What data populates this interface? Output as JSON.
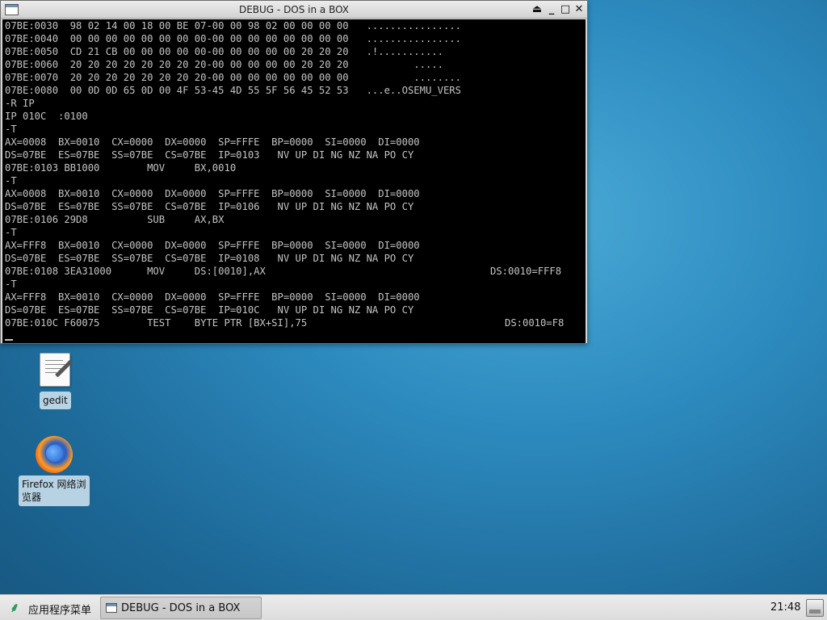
{
  "window": {
    "title": "DEBUG - DOS in a BOX",
    "controls": {
      "shade": "⏏",
      "minimize": "_",
      "maximize": "□",
      "close": "✕"
    },
    "lines": [
      "07BE:0030  98 02 14 00 18 00 BE 07-00 00 98 02 00 00 00 00   ................",
      "07BE:0040  00 00 00 00 00 00 00 00-00 00 00 00 00 00 00 00   ................",
      "07BE:0050  CD 21 CB 00 00 00 00 00-00 00 00 00 00 20 20 20   .!...........",
      "07BE:0060  20 20 20 20 20 20 20 20-00 00 00 00 00 20 20 20           .....",
      "07BE:0070  20 20 20 20 20 20 20 20-00 00 00 00 00 00 00 00           ........",
      "07BE:0080  00 0D 0D 65 0D 00 4F 53-45 4D 55 5F 56 45 52 53   ...e..OSEMU_VERS",
      "-R IP",
      "IP 010C  :0100",
      "-T",
      "AX=0008  BX=0010  CX=0000  DX=0000  SP=FFFE  BP=0000  SI=0000  DI=0000",
      "DS=07BE  ES=07BE  SS=07BE  CS=07BE  IP=0103   NV UP DI NG NZ NA PO CY",
      "07BE:0103 BB1000        MOV     BX,0010",
      "-T",
      "AX=0008  BX=0010  CX=0000  DX=0000  SP=FFFE  BP=0000  SI=0000  DI=0000",
      "DS=07BE  ES=07BE  SS=07BE  CS=07BE  IP=0106   NV UP DI NG NZ NA PO CY",
      "07BE:0106 29D8          SUB     AX,BX",
      "-T",
      "AX=FFF8  BX=0010  CX=0000  DX=0000  SP=FFFE  BP=0000  SI=0000  DI=0000",
      "DS=07BE  ES=07BE  SS=07BE  CS=07BE  IP=0108   NV UP DI NG NZ NA PO CY",
      "07BE:0108 3EA31000      MOV     DS:[0010],AX",
      "-T",
      "AX=FFF8  BX=0010  CX=0000  DX=0000  SP=FFFE  BP=0000  SI=0000  DI=0000",
      "DS=07BE  ES=07BE  SS=07BE  CS=07BE  IP=010C   NV UP DI NG NZ NA PO CY",
      "07BE:010C F60075        TEST    BYTE PTR [BX+SI],75"
    ],
    "annotations": {
      "line19": "DS:0010=FFF8",
      "line23": "DS:0010=F8"
    }
  },
  "desktop": {
    "gedit_label": "gedit",
    "firefox_label_line1": "Firefox 网络浏",
    "firefox_label_line2": "览器"
  },
  "taskbar": {
    "menu_label": "应用程序菜单",
    "task_label": "DEBUG - DOS in a BOX",
    "clock": "21:48"
  },
  "colors": {
    "terminal_bg": "#000000",
    "terminal_fg": "#c4c4c4",
    "desktop": "#2e8cc0"
  }
}
